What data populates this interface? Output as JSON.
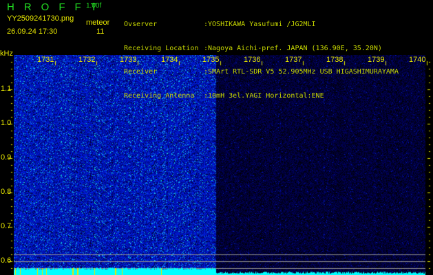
{
  "header": {
    "app_title": "HROFFT",
    "version": "1.00f",
    "filename": "YY2509241730.png",
    "datetime": "26.09.24 17:30",
    "meteor_label": "meteor",
    "meteor_count": "11"
  },
  "info": [
    {
      "label": "Ovserver",
      "value": ":YOSHIKAWA Yasufumi /JG2MLI"
    },
    {
      "label": "Receiving Location",
      "value": ":Nagoya Aichi-pref. JAPAN (136.90E, 35.20N)"
    },
    {
      "label": "Receiver",
      "value": ":SMArt RTL-SDR V5 52.905MHz USB HIGASHIMURAYAMA"
    },
    {
      "label": "Receiving Antenna",
      "value": ":10mH 3el.YAGI Horizontal:ENE"
    }
  ],
  "spectrogram": {
    "y_unit": "kHz",
    "y_ticks": [
      "1.1",
      "1.0",
      "0.9",
      "0.8",
      "0.7",
      "0.6"
    ],
    "time_labels": [
      "1731",
      "1732",
      "1733",
      "1734",
      "1735",
      "1736",
      "1737",
      "1738",
      "1739",
      "1740"
    ],
    "colors": {
      "noise_strong": "#1a2adf",
      "noise_weak": "#0a0a60",
      "meteor_bar": "#00ffff",
      "tick": "#e8e800",
      "guide_line": "#909090"
    }
  }
}
